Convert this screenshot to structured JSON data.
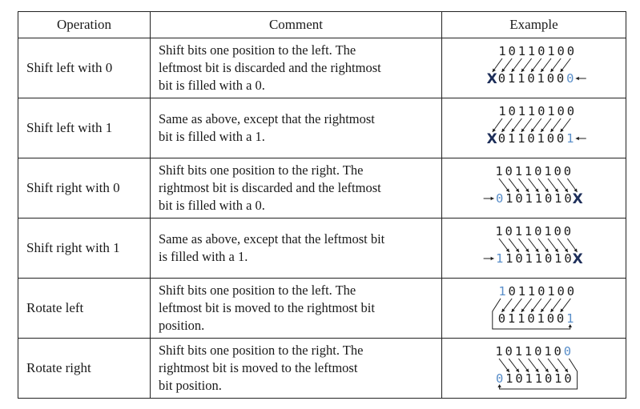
{
  "headers": {
    "operation": "Operation",
    "comment": "Comment",
    "example": "Example"
  },
  "rows": [
    {
      "operation": "Shift left with 0",
      "comment": [
        "Shift bits one position to the left. The",
        "leftmost bit is discarded and the rightmost",
        "bit is filled with a 0."
      ],
      "example": {
        "direction": "left",
        "top": "10110100",
        "bottom": "01101000",
        "fill_bit": "0",
        "discarded": "X",
        "rotate": false
      }
    },
    {
      "operation": "Shift left with 1",
      "comment": [
        "Same as above, except that the rightmost",
        "bit is filled with a 1."
      ],
      "example": {
        "direction": "left",
        "top": "10110100",
        "bottom": "01101001",
        "fill_bit": "1",
        "discarded": "X",
        "rotate": false
      }
    },
    {
      "operation": "Shift right with 0",
      "comment": [
        "Shift bits one position to the right. The",
        "rightmost bit is discarded and the leftmost",
        "bit is filled with a 0."
      ],
      "example": {
        "direction": "right",
        "top": "10110100",
        "bottom": "01011010",
        "fill_bit": "0",
        "discarded": "X",
        "rotate": false
      }
    },
    {
      "operation": "Shift right with 1",
      "comment": [
        "Same as above, except that the leftmost bit",
        "is filled with a 1."
      ],
      "example": {
        "direction": "right",
        "top": "10110100",
        "bottom": "11011010",
        "fill_bit": "1",
        "discarded": "X",
        "rotate": false
      }
    },
    {
      "operation": "Rotate left",
      "comment": [
        "Shift bits one position to the left. The",
        "leftmost bit is moved to the rightmost bit",
        "position."
      ],
      "example": {
        "direction": "left",
        "top": "10110100",
        "bottom": "01101001",
        "fill_bit": "1",
        "discarded": "",
        "rotate": true
      }
    },
    {
      "operation": "Rotate right",
      "comment": [
        "Shift bits one position to the right. The",
        "rightmost bit is moved to the leftmost",
        "bit position."
      ],
      "example": {
        "direction": "right",
        "top": "10110100",
        "bottom": "01011010",
        "fill_bit": "0",
        "discarded": "",
        "rotate": true
      }
    }
  ],
  "colors": {
    "highlight_bit": "#5b8fc9",
    "discard_mark": "#1e2f5a",
    "border": "#222222"
  }
}
